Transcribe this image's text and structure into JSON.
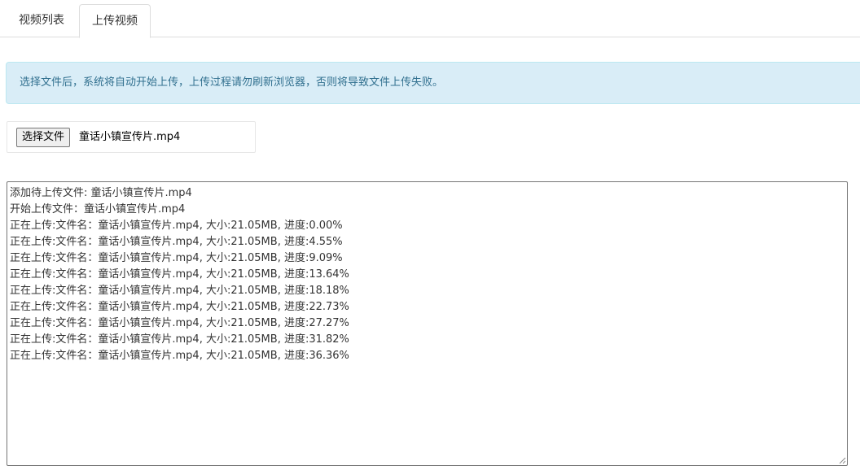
{
  "tabs": [
    {
      "label": "视频列表",
      "active": false
    },
    {
      "label": "上传视频",
      "active": true
    }
  ],
  "alert": {
    "text": "选择文件后，系统将自动开始上传，上传过程请勿刷新浏览器，否则将导致文件上传失败。"
  },
  "file_input": {
    "button_label": "选择文件",
    "file_name": "童话小镇宣传片.mp4"
  },
  "log": {
    "lines": [
      "添加待上传文件: 童话小镇宣传片.mp4",
      "开始上传文件：童话小镇宣传片.mp4",
      "正在上传:文件名：童话小镇宣传片.mp4, 大小:21.05MB, 进度:0.00%",
      "正在上传:文件名：童话小镇宣传片.mp4, 大小:21.05MB, 进度:4.55%",
      "正在上传:文件名：童话小镇宣传片.mp4, 大小:21.05MB, 进度:9.09%",
      "正在上传:文件名：童话小镇宣传片.mp4, 大小:21.05MB, 进度:13.64%",
      "正在上传:文件名：童话小镇宣传片.mp4, 大小:21.05MB, 进度:18.18%",
      "正在上传:文件名：童话小镇宣传片.mp4, 大小:21.05MB, 进度:22.73%",
      "正在上传:文件名：童话小镇宣传片.mp4, 大小:21.05MB, 进度:27.27%",
      "正在上传:文件名：童话小镇宣传片.mp4, 大小:21.05MB, 进度:31.82%",
      "正在上传:文件名：童话小镇宣传片.mp4, 大小:21.05MB, 进度:36.36%"
    ]
  },
  "colors": {
    "alert_bg": "#d9edf7",
    "alert_text": "#31708f",
    "alert_border": "#bce8f1"
  }
}
